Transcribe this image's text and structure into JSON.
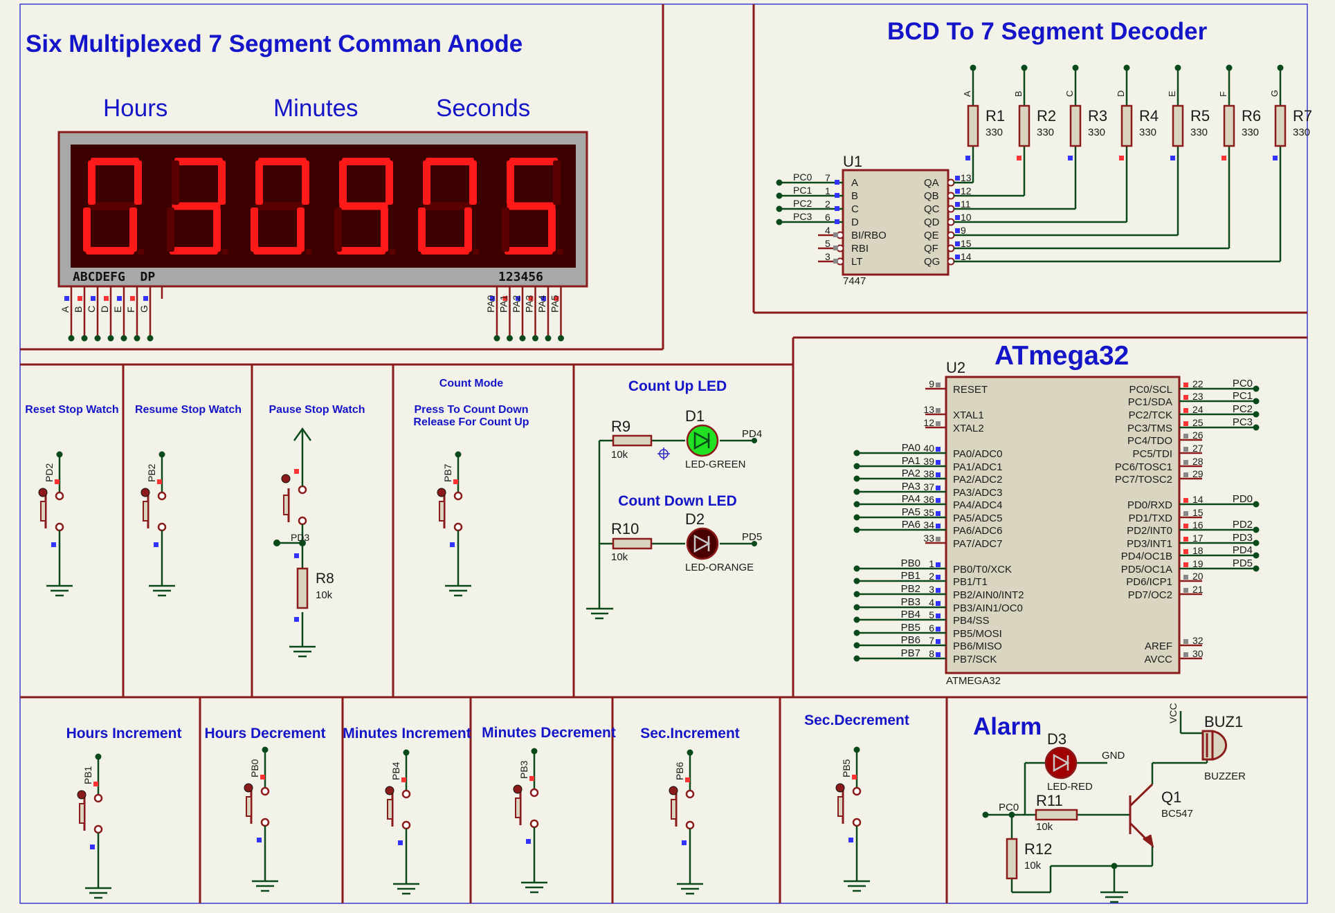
{
  "colors": {
    "wire": "#0a4a1a",
    "border": "#8b1a1a",
    "title": "#1414c8",
    "component": "#8b1a1a",
    "body": "#d9d5c0",
    "segment_on": "#ff1a1a",
    "segment_off": "#5a0000"
  },
  "display": {
    "title": "Six Multiplexed 7 Segment Comman Anode",
    "hours_label": "Hours",
    "minutes_label": "Minutes",
    "seconds_label": "Seconds",
    "digits": [
      "0",
      "3",
      "0",
      "9",
      "0",
      "5"
    ],
    "seg_strip": "ABCDEFG  DP",
    "digit_strip": "123456",
    "seg_pins": [
      "A",
      "B",
      "C",
      "D",
      "E",
      "F",
      "G"
    ],
    "digit_pins": [
      "PA0",
      "PA1",
      "PA2",
      "PA3",
      "PA4",
      "PA5"
    ]
  },
  "decoder": {
    "title": "BCD To 7 Segment Decoder",
    "ref": "U1",
    "part": "7447",
    "inputs": [
      {
        "net": "PC0",
        "num": "7",
        "name": "A"
      },
      {
        "net": "PC1",
        "num": "1",
        "name": "B"
      },
      {
        "net": "PC2",
        "num": "2",
        "name": "C"
      },
      {
        "net": "PC3",
        "num": "6",
        "name": "D"
      }
    ],
    "controls": [
      {
        "num": "4",
        "name": "BI/RBO"
      },
      {
        "num": "5",
        "name": "RBI"
      },
      {
        "num": "3",
        "name": "LT"
      }
    ],
    "outputs": [
      {
        "name": "QA",
        "num": "13"
      },
      {
        "name": "QB",
        "num": "12"
      },
      {
        "name": "QC",
        "num": "11"
      },
      {
        "name": "QD",
        "num": "10"
      },
      {
        "name": "QE",
        "num": "9"
      },
      {
        "name": "QF",
        "num": "15"
      },
      {
        "name": "QG",
        "num": "14"
      }
    ],
    "resistors": [
      {
        "ref": "R1",
        "val": "330",
        "net": "A"
      },
      {
        "ref": "R2",
        "val": "330",
        "net": "B"
      },
      {
        "ref": "R3",
        "val": "330",
        "net": "C"
      },
      {
        "ref": "R4",
        "val": "330",
        "net": "D"
      },
      {
        "ref": "R5",
        "val": "330",
        "net": "E"
      },
      {
        "ref": "R6",
        "val": "330",
        "net": "F"
      },
      {
        "ref": "R7",
        "val": "330",
        "net": "G"
      }
    ]
  },
  "mcu": {
    "title": "ATmega32",
    "ref": "U2",
    "part": "ATMEGA32",
    "left_pins": [
      {
        "num": "9",
        "name": "RESET",
        "net": ""
      },
      {
        "num": "13",
        "name": "XTAL1",
        "net": ""
      },
      {
        "num": "12",
        "name": "XTAL2",
        "net": ""
      },
      {
        "num": "40",
        "name": "PA0/ADC0",
        "net": "PA0"
      },
      {
        "num": "39",
        "name": "PA1/ADC1",
        "net": "PA1"
      },
      {
        "num": "38",
        "name": "PA2/ADC2",
        "net": "PA2"
      },
      {
        "num": "37",
        "name": "PA3/ADC3",
        "net": "PA3"
      },
      {
        "num": "36",
        "name": "PA4/ADC4",
        "net": "PA4"
      },
      {
        "num": "35",
        "name": "PA5/ADC5",
        "net": "PA5"
      },
      {
        "num": "34",
        "name": "PA6/ADC6",
        "net": "PA6"
      },
      {
        "num": "33",
        "name": "PA7/ADC7",
        "net": ""
      },
      {
        "num": "1",
        "name": "PB0/T0/XCK",
        "net": "PB0"
      },
      {
        "num": "2",
        "name": "PB1/T1",
        "net": "PB1"
      },
      {
        "num": "3",
        "name": "PB2/AIN0/INT2",
        "net": "PB2"
      },
      {
        "num": "4",
        "name": "PB3/AIN1/OC0",
        "net": "PB3"
      },
      {
        "num": "5",
        "name": "PB4/SS",
        "net": "PB4"
      },
      {
        "num": "6",
        "name": "PB5/MOSI",
        "net": "PB5"
      },
      {
        "num": "7",
        "name": "PB6/MISO",
        "net": "PB6"
      },
      {
        "num": "8",
        "name": "PB7/SCK",
        "net": "PB7"
      }
    ],
    "right_pins": [
      {
        "num": "22",
        "name": "PC0/SCL",
        "net": "PC0"
      },
      {
        "num": "23",
        "name": "PC1/SDA",
        "net": "PC1"
      },
      {
        "num": "24",
        "name": "PC2/TCK",
        "net": "PC2"
      },
      {
        "num": "25",
        "name": "PC3/TMS",
        "net": "PC3"
      },
      {
        "num": "26",
        "name": "PC4/TDO",
        "net": ""
      },
      {
        "num": "27",
        "name": "PC5/TDI",
        "net": ""
      },
      {
        "num": "28",
        "name": "PC6/TOSC1",
        "net": ""
      },
      {
        "num": "29",
        "name": "PC7/TOSC2",
        "net": ""
      },
      {
        "num": "14",
        "name": "PD0/RXD",
        "net": "PD0"
      },
      {
        "num": "15",
        "name": "PD1/TXD",
        "net": ""
      },
      {
        "num": "16",
        "name": "PD2/INT0",
        "net": "PD2"
      },
      {
        "num": "17",
        "name": "PD3/INT1",
        "net": "PD3"
      },
      {
        "num": "18",
        "name": "PD4/OC1B",
        "net": "PD4"
      },
      {
        "num": "19",
        "name": "PD5/OC1A",
        "net": "PD5"
      },
      {
        "num": "20",
        "name": "PD6/ICP1",
        "net": ""
      },
      {
        "num": "21",
        "name": "PD7/OC2",
        "net": ""
      },
      {
        "num": "32",
        "name": "AREF",
        "net": ""
      },
      {
        "num": "30",
        "name": "AVCC",
        "net": ""
      }
    ]
  },
  "controls": {
    "reset": {
      "title": "Reset Stop Watch",
      "net": "PD2"
    },
    "resume": {
      "title": "Resume Stop Watch",
      "net": "PB2"
    },
    "pause": {
      "title": "Pause Stop Watch",
      "net": "PD3",
      "r_ref": "R8",
      "r_val": "10k"
    },
    "mode": {
      "title": "Count Mode",
      "line1": "Press To Count Down",
      "line2": "Release For Count Up",
      "net": "PB7"
    }
  },
  "leds": {
    "up_title": "Count Up LED",
    "up_ref": "D1",
    "up_part": "LED-GREEN",
    "up_r": "R9",
    "up_rval": "10k",
    "up_net": "PD4",
    "down_title": "Count Down LED",
    "down_ref": "D2",
    "down_part": "LED-ORANGE",
    "down_r": "R10",
    "down_rval": "10k",
    "down_net": "PD5"
  },
  "buttons": [
    {
      "title": "Hours Increment",
      "net": "PB1"
    },
    {
      "title": "Hours Decrement",
      "net": "PB0"
    },
    {
      "title": "Minutes Increment",
      "net": "PB4"
    },
    {
      "title": "Minutes Decrement",
      "net": "PB3"
    },
    {
      "title": "Sec.Increment",
      "net": "PB6"
    },
    {
      "title": "Sec.Decrement",
      "net": "PB5"
    }
  ],
  "alarm": {
    "title": "Alarm",
    "led_ref": "D3",
    "led_part": "LED-RED",
    "gnd": "GND",
    "buz_ref": "BUZ1",
    "buz_part": "BUZZER",
    "vcc": "VCC",
    "q_ref": "Q1",
    "q_part": "BC547",
    "r11": "R11",
    "r11_val": "10k",
    "r12": "R12",
    "r12_val": "10k",
    "net": "PC0"
  }
}
